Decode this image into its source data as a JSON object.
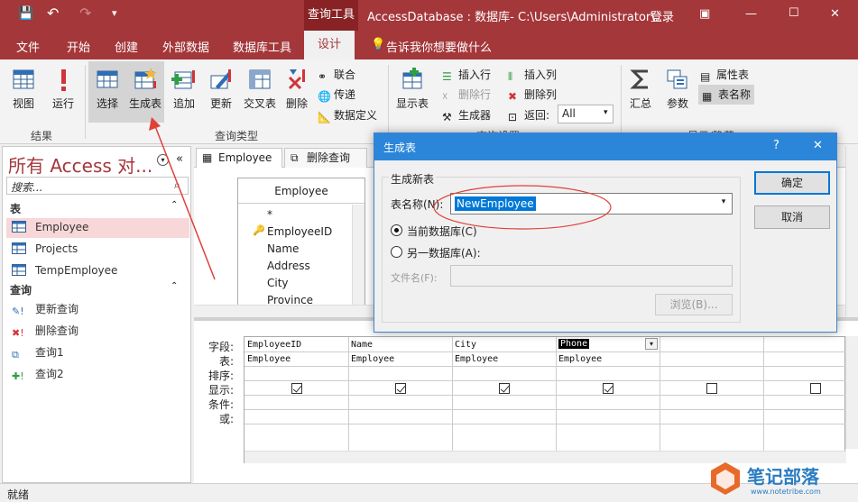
{
  "app": {
    "window_title": "AccessDatabase : 数据库- C:\\Users\\Administrator\\...",
    "context_tab": "查询工具",
    "login": "登录",
    "minimize": "—",
    "restore": "☐",
    "close": "✕"
  },
  "quick_access": {
    "save": "💾",
    "undo": "↶",
    "redo": "↷",
    "customize": "▾"
  },
  "ribbon_tabs": [
    "文件",
    "开始",
    "创建",
    "外部数据",
    "数据库工具",
    "设计"
  ],
  "tell_me": "告诉我你想要做什么",
  "ribbon": {
    "results": {
      "view": "视图",
      "run": "运行",
      "group": "结果"
    },
    "query_type": {
      "select": "选择",
      "make_table": "生成表",
      "append": "追加",
      "update": "更新",
      "crosstab": "交叉表",
      "delete": "删除",
      "union": "联合",
      "passthrough": "传递",
      "data_definition": "数据定义",
      "group": "查询类型"
    },
    "setup": {
      "show_table": "显示表",
      "insert_rows": "插入行",
      "delete_rows": "删除行",
      "builder": "生成器",
      "insert_cols": "插入列",
      "delete_cols": "删除列",
      "return": "返回:",
      "return_value": "All",
      "group": "查询设置"
    },
    "showhide": {
      "totals": "汇总",
      "params": "参数",
      "property_sheet": "属性表",
      "table_names": "表名称",
      "group": "显示/隐藏"
    }
  },
  "nav": {
    "title": "所有 Access 对...",
    "search_placeholder": "搜索...",
    "tables_header": "表",
    "tables": [
      "Employee",
      "Projects",
      "TempEmployee"
    ],
    "queries_header": "查询",
    "queries": [
      "更新查询",
      "删除查询",
      "查询1",
      "查询2"
    ]
  },
  "doc_tabs": [
    "Employee",
    "删除查询"
  ],
  "table_box": {
    "title": "Employee",
    "fields": [
      "*",
      "EmployeeID",
      "Name",
      "Address",
      "City",
      "Province"
    ]
  },
  "grid": {
    "row_labels": [
      "字段:",
      "表:",
      "排序:",
      "显示:",
      "条件:",
      "或:"
    ],
    "columns": [
      {
        "field": "EmployeeID",
        "table": "Employee",
        "show": true
      },
      {
        "field": "Name",
        "table": "Employee",
        "show": true
      },
      {
        "field": "City",
        "table": "Employee",
        "show": true
      },
      {
        "field": "Phone",
        "table": "Employee",
        "show": true
      },
      {
        "field": "",
        "table": "",
        "show": false
      },
      {
        "field": "",
        "table": "",
        "show": false
      }
    ]
  },
  "dialog": {
    "title": "生成表",
    "help": "?",
    "close": "✕",
    "group_label": "生成新表",
    "table_name_label": "表名称(N):",
    "table_name_value": "NewEmployee",
    "current_db": "当前数据库(C)",
    "other_db": "另一数据库(A):",
    "file_name_label": "文件名(F):",
    "browse": "浏览(B)...",
    "ok": "确定",
    "cancel": "取消"
  },
  "status": "就绪",
  "watermark": {
    "text": "笔记部落",
    "url": "www.notetribe.com"
  },
  "colors": {
    "accent": "#a4373a",
    "dialog_title": "#2b86d9",
    "annotation": "#e0403a"
  }
}
